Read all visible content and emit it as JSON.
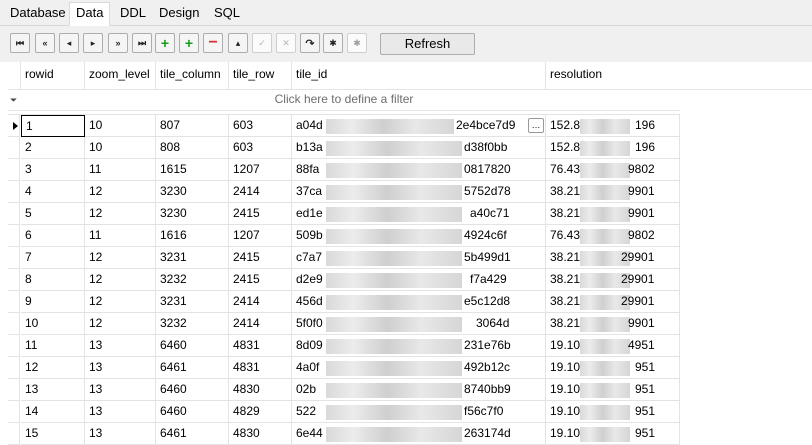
{
  "tabs": [
    {
      "label": "Database"
    },
    {
      "label": "Data",
      "active": true
    },
    {
      "label": "DDL"
    },
    {
      "label": "Design"
    },
    {
      "label": "SQL"
    }
  ],
  "toolbar": {
    "buttons": [
      {
        "name": "first-record-button",
        "glyph": "⏮"
      },
      {
        "name": "prior-page-button",
        "glyph": "«"
      },
      {
        "name": "prior-record-button",
        "glyph": "◂"
      },
      {
        "name": "next-record-button",
        "glyph": "▸"
      },
      {
        "name": "next-page-button",
        "glyph": "»"
      },
      {
        "name": "last-record-button",
        "glyph": "⏭"
      },
      {
        "name": "insert-record-button",
        "glyph": "+"
      },
      {
        "name": "append-record-button",
        "glyph": "+"
      },
      {
        "name": "delete-record-button",
        "glyph": "−"
      },
      {
        "name": "edit-record-button",
        "glyph": "▴"
      },
      {
        "name": "post-edit-button",
        "glyph": "✓"
      },
      {
        "name": "cancel-edit-button",
        "glyph": "✕"
      },
      {
        "name": "refresh-data-button",
        "glyph": "↷"
      },
      {
        "name": "set-null-button",
        "glyph": "✱"
      },
      {
        "name": "apply-filter-button",
        "glyph": "✱"
      }
    ],
    "refresh_label": "Refresh",
    "accent_green": "#1a9a1a",
    "accent_red": "#d9312b"
  },
  "grid": {
    "columns": [
      "rowid",
      "zoom_level",
      "tile_column",
      "tile_row",
      "tile_id",
      "resolution"
    ],
    "filter_placeholder": "Click here to define a filter",
    "rows": [
      {
        "rowid": "1",
        "zoom_level": "10",
        "tile_column": "807",
        "tile_row": "603",
        "tile_id_start": "a04d",
        "tile_id_end": "2e4bce7d9",
        "res_start": "152.8",
        "res_end": "196"
      },
      {
        "rowid": "2",
        "zoom_level": "10",
        "tile_column": "808",
        "tile_row": "603",
        "tile_id_start": "b13a",
        "tile_id_end": "d38f0bb",
        "res_start": "152.8",
        "res_end": "196"
      },
      {
        "rowid": "3",
        "zoom_level": "11",
        "tile_column": "1615",
        "tile_row": "1207",
        "tile_id_start": "88fa",
        "tile_id_end": "0817820",
        "res_start": "76.43",
        "res_end": "9802"
      },
      {
        "rowid": "4",
        "zoom_level": "12",
        "tile_column": "3230",
        "tile_row": "2414",
        "tile_id_start": "37ca",
        "tile_id_end": "5752d78",
        "res_start": "38.21",
        "res_end": "9901"
      },
      {
        "rowid": "5",
        "zoom_level": "12",
        "tile_column": "3230",
        "tile_row": "2415",
        "tile_id_start": "ed1e",
        "tile_id_end": "a40c71",
        "res_start": "38.21",
        "res_end": "9901"
      },
      {
        "rowid": "6",
        "zoom_level": "11",
        "tile_column": "1616",
        "tile_row": "1207",
        "tile_id_start": "509b",
        "tile_id_end": "4924c6f",
        "res_start": "76.43",
        "res_end": "9802"
      },
      {
        "rowid": "7",
        "zoom_level": "12",
        "tile_column": "3231",
        "tile_row": "2415",
        "tile_id_start": "c7a7",
        "tile_id_end": "5b499d1",
        "res_start": "38.21",
        "res_end": "29901"
      },
      {
        "rowid": "8",
        "zoom_level": "12",
        "tile_column": "3232",
        "tile_row": "2415",
        "tile_id_start": "d2e9",
        "tile_id_end": "f7a429",
        "res_start": "38.21",
        "res_end": "29901"
      },
      {
        "rowid": "9",
        "zoom_level": "12",
        "tile_column": "3231",
        "tile_row": "2414",
        "tile_id_start": "456d",
        "tile_id_end": "e5c12d8",
        "res_start": "38.21",
        "res_end": "29901"
      },
      {
        "rowid": "10",
        "zoom_level": "12",
        "tile_column": "3232",
        "tile_row": "2414",
        "tile_id_start": "5f0f0",
        "tile_id_end": "3064d",
        "res_start": "38.21",
        "res_end": "9901"
      },
      {
        "rowid": "11",
        "zoom_level": "13",
        "tile_column": "6460",
        "tile_row": "4831",
        "tile_id_start": "8d09",
        "tile_id_end": "231e76b",
        "res_start": "19.10",
        "res_end": "4951"
      },
      {
        "rowid": "12",
        "zoom_level": "13",
        "tile_column": "6461",
        "tile_row": "4831",
        "tile_id_start": "4a0f",
        "tile_id_end": "492b12c",
        "res_start": "19.10",
        "res_end": "951"
      },
      {
        "rowid": "13",
        "zoom_level": "13",
        "tile_column": "6460",
        "tile_row": "4830",
        "tile_id_start": "02b",
        "tile_id_end": "8740bb9",
        "res_start": "19.10",
        "res_end": "951"
      },
      {
        "rowid": "14",
        "zoom_level": "13",
        "tile_column": "6460",
        "tile_row": "4829",
        "tile_id_start": "522",
        "tile_id_end": "f56c7f0",
        "res_start": "19.10",
        "res_end": "951"
      },
      {
        "rowid": "15",
        "zoom_level": "13",
        "tile_column": "6461",
        "tile_row": "4830",
        "tile_id_start": "6e44",
        "tile_id_end": "263174d",
        "res_start": "19.10",
        "res_end": "951"
      }
    ]
  }
}
